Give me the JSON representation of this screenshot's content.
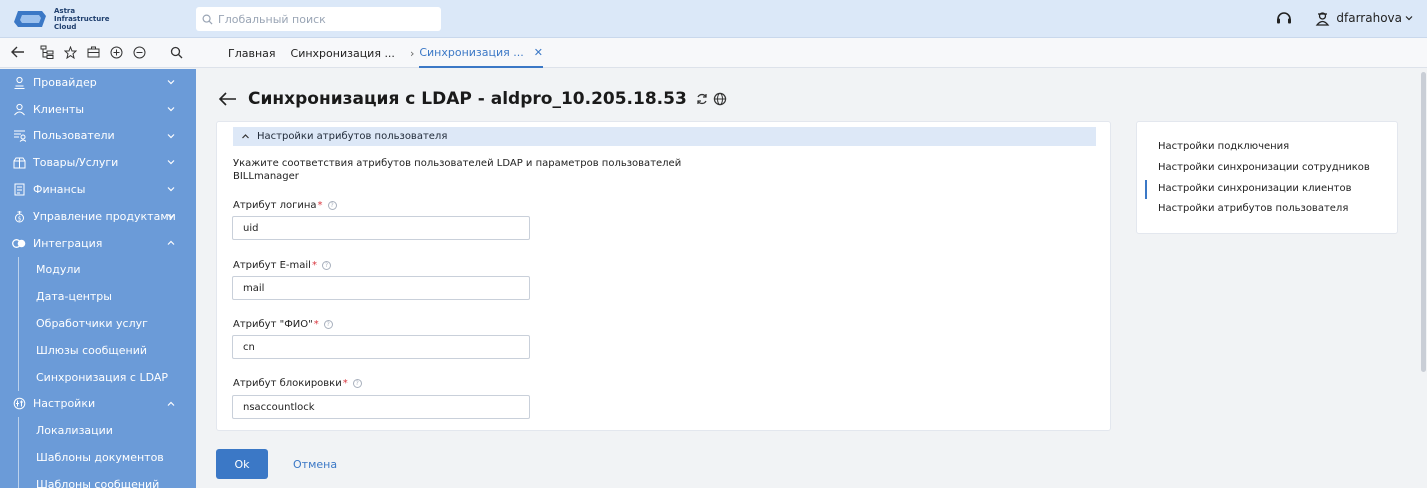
{
  "app": {
    "logo_text": "Astra\nInfrastructure\nCloud",
    "search_placeholder": "Глобальный поиск",
    "username": "dfarrahova"
  },
  "tabs": [
    {
      "label": "Главная",
      "active": false
    },
    {
      "label": "Синхронизация ...",
      "active": false
    },
    {
      "label": "Синхронизация ...",
      "active": true
    }
  ],
  "sidebar": {
    "items": [
      {
        "label": "Провайдер",
        "icon": "provider-icon",
        "expanded": false
      },
      {
        "label": "Клиенты",
        "icon": "clients-icon",
        "expanded": false
      },
      {
        "label": "Пользователи",
        "icon": "users-icon",
        "expanded": false
      },
      {
        "label": "Товары/Услуги",
        "icon": "products-icon",
        "expanded": false
      },
      {
        "label": "Финансы",
        "icon": "finance-icon",
        "expanded": false
      },
      {
        "label": "Управление продуктами",
        "icon": "product-management-icon",
        "expanded": false
      },
      {
        "label": "Интеграция",
        "icon": "integration-icon",
        "expanded": true
      }
    ],
    "integration_sub": [
      "Модули",
      "Дата-центры",
      "Обработчики услуг",
      "Шлюзы сообщений",
      "Синхронизация с LDAP"
    ],
    "settings": {
      "label": "Настройки",
      "icon": "settings-icon",
      "expanded": true
    },
    "settings_sub": [
      "Локализации",
      "Шаблоны документов",
      "Шаблоны сообщений"
    ]
  },
  "page": {
    "title": "Синхронизация с LDAP - aldpro_10.205.18.53"
  },
  "section": {
    "title": "Настройки атрибутов пользователя",
    "description_line1": "Укажите соответствия атрибутов пользователей LDAP и параметров пользователей",
    "description_line2": "BILLmanager"
  },
  "fields": [
    {
      "label": "Атрибут логина",
      "required_mark": "*",
      "value": "uid"
    },
    {
      "label": "Атрибут E-mail",
      "required_mark": "*",
      "value": "mail"
    },
    {
      "label": "Атрибут \"ФИО\"",
      "required_mark": "*",
      "value": "cn"
    },
    {
      "label": "Атрибут блокировки",
      "required_mark": "*",
      "value": "nsaccountlock"
    }
  ],
  "help_glyph": "?",
  "buttons": {
    "ok": "Ok",
    "cancel": "Отмена"
  },
  "right_nav": {
    "items": [
      "Настройки подключения",
      "Настройки синхронизации сотрудников",
      "Настройки синхронизации клиентов",
      "Настройки атрибутов пользователя"
    ],
    "active_index": 2
  },
  "colors": {
    "accent": "#3b78c6",
    "sidebar_bg": "#6b9bd8",
    "header_bg": "#dbe8f8",
    "required": "#d9363e"
  }
}
